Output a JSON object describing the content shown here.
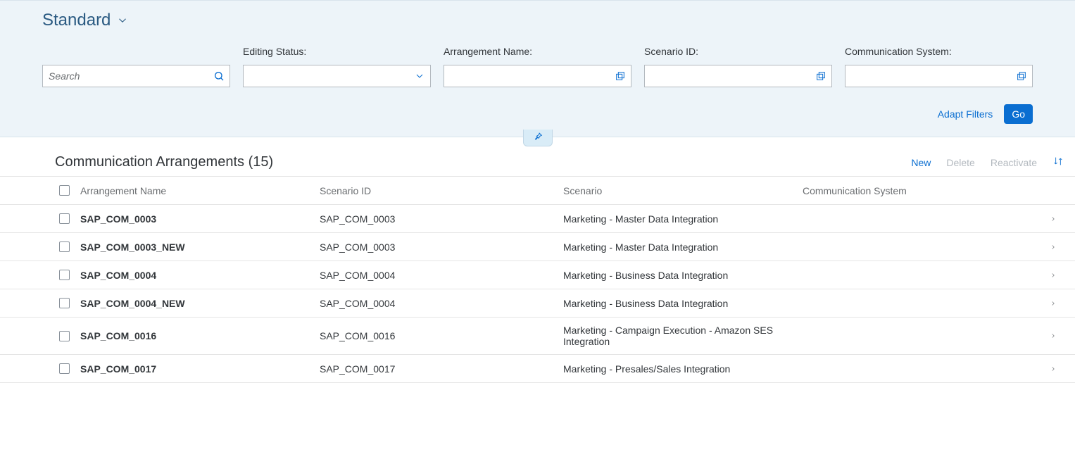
{
  "variant": {
    "title": "Standard"
  },
  "filters": {
    "search_placeholder": "Search",
    "editing_status": {
      "label": "Editing Status:",
      "value": ""
    },
    "arrangement_name": {
      "label": "Arrangement Name:",
      "value": ""
    },
    "scenario_id": {
      "label": "Scenario ID:",
      "value": ""
    },
    "communication_system": {
      "label": "Communication System:",
      "value": ""
    }
  },
  "actions": {
    "adapt_filters": "Adapt Filters",
    "go": "Go"
  },
  "table": {
    "title": "Communication Arrangements (15)",
    "toolbar": {
      "new": "New",
      "delete": "Delete",
      "reactivate": "Reactivate"
    },
    "columns": {
      "arrangement_name": "Arrangement Name",
      "scenario_id": "Scenario ID",
      "scenario": "Scenario",
      "communication_system": "Communication System"
    },
    "rows": [
      {
        "name": "SAP_COM_0003",
        "sid": "SAP_COM_0003",
        "scenario": "Marketing - Master Data Integration",
        "system": ""
      },
      {
        "name": "SAP_COM_0003_NEW",
        "sid": "SAP_COM_0003",
        "scenario": "Marketing - Master Data Integration",
        "system": ""
      },
      {
        "name": "SAP_COM_0004",
        "sid": "SAP_COM_0004",
        "scenario": "Marketing - Business Data Integration",
        "system": ""
      },
      {
        "name": "SAP_COM_0004_NEW",
        "sid": "SAP_COM_0004",
        "scenario": "Marketing - Business Data Integration",
        "system": ""
      },
      {
        "name": "SAP_COM_0016",
        "sid": "SAP_COM_0016",
        "scenario": "Marketing - Campaign Execution - Amazon SES Integration",
        "system": ""
      },
      {
        "name": "SAP_COM_0017",
        "sid": "SAP_COM_0017",
        "scenario": "Marketing - Presales/Sales Integration",
        "system": ""
      }
    ]
  }
}
